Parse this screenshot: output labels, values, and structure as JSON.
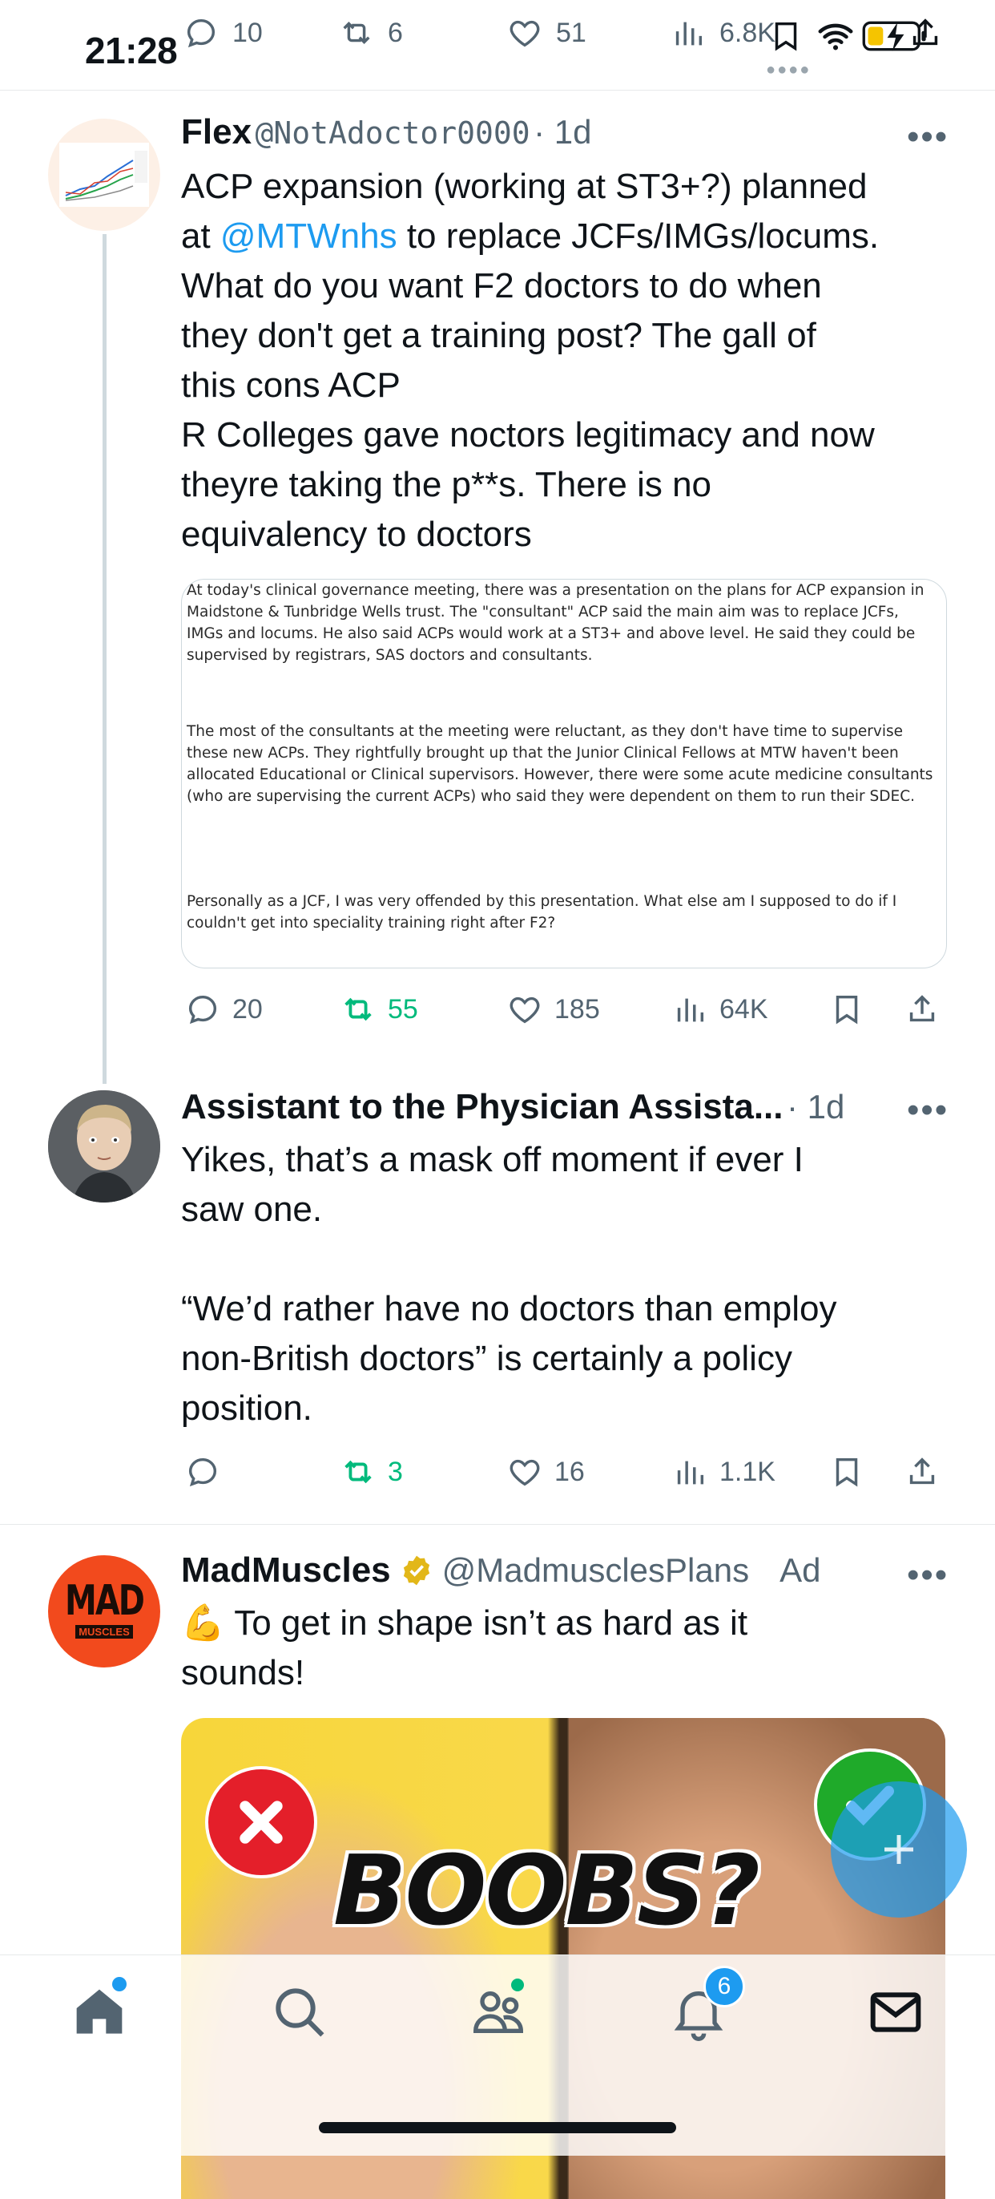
{
  "status_bar": {
    "time": "21:28"
  },
  "top_stats": {
    "replies": "10",
    "reposts": "6",
    "likes": "51",
    "views": "6.8K"
  },
  "tweets": [
    {
      "name": "Flex",
      "handle": "@NotAdoctor0000",
      "age": "· 1d",
      "text_lines": [
        "ACP expansion (working at ST3+?) planned",
        "to replace JCFs/IMGs/locums.",
        "What do you want F2 doctors to do when",
        "they don't get a training post? The gall of",
        "this cons ACP",
        "R Colleges gave noctors legitimacy and now",
        "theyre taking the p**s. There is no",
        "equivalency to doctors"
      ],
      "line2_prefix": "at ",
      "mention": "@MTWnhs",
      "image_paragraphs": [
        "At today's clinical governance meeting, there was a presentation on the plans for ACP expansion in Maidstone & Tunbridge Wells trust. The \"consultant\" ACP said the main aim was to replace JCFs, IMGs and locums. He also said ACPs would work at a ST3+ and above level. He said they could be supervised by registrars, SAS doctors and consultants.",
        "The most of the consultants at the meeting were reluctant, as they don't have time to supervise these new ACPs. They rightfully brought up that the Junior Clinical Fellows at MTW haven't been allocated Educational or Clinical supervisors. However, there were some acute medicine consultants (who are supervising the current ACPs) who said they were dependent on them to run their SDEC.",
        "Personally as a JCF, I was very offended by this presentation. What else am I supposed to do if I couldn't get into speciality training right after F2?"
      ],
      "stats": {
        "replies": "20",
        "reposts": "55",
        "likes": "185",
        "views": "64K"
      }
    },
    {
      "name": "Assistant to the Physician Assista...",
      "age": "· 1d",
      "text_lines": [
        "Yikes, that’s a mask off moment if ever I",
        "saw one.",
        "“We’d rather have no doctors than employ",
        "non-British doctors” is certainly a policy",
        "position."
      ],
      "stats": {
        "reposts": "3",
        "likes": "16",
        "views": "1.1K"
      }
    },
    {
      "name": "MadMuscles",
      "handle": "@MadmusclesPlans",
      "badge": "Ad",
      "avatar_text": [
        "MAD",
        "MUSCLES"
      ],
      "emoji": "💪",
      "text_lines": [
        "To get in shape isn’t as hard as it",
        "sounds!"
      ],
      "image_text": "BOOBS?"
    }
  ],
  "bottom_nav": {
    "notifications_count": "6"
  },
  "colors": {
    "accent": "#1d9bf0",
    "repost_active": "#00ba7c",
    "text": "#0f1419",
    "muted": "#536471"
  }
}
